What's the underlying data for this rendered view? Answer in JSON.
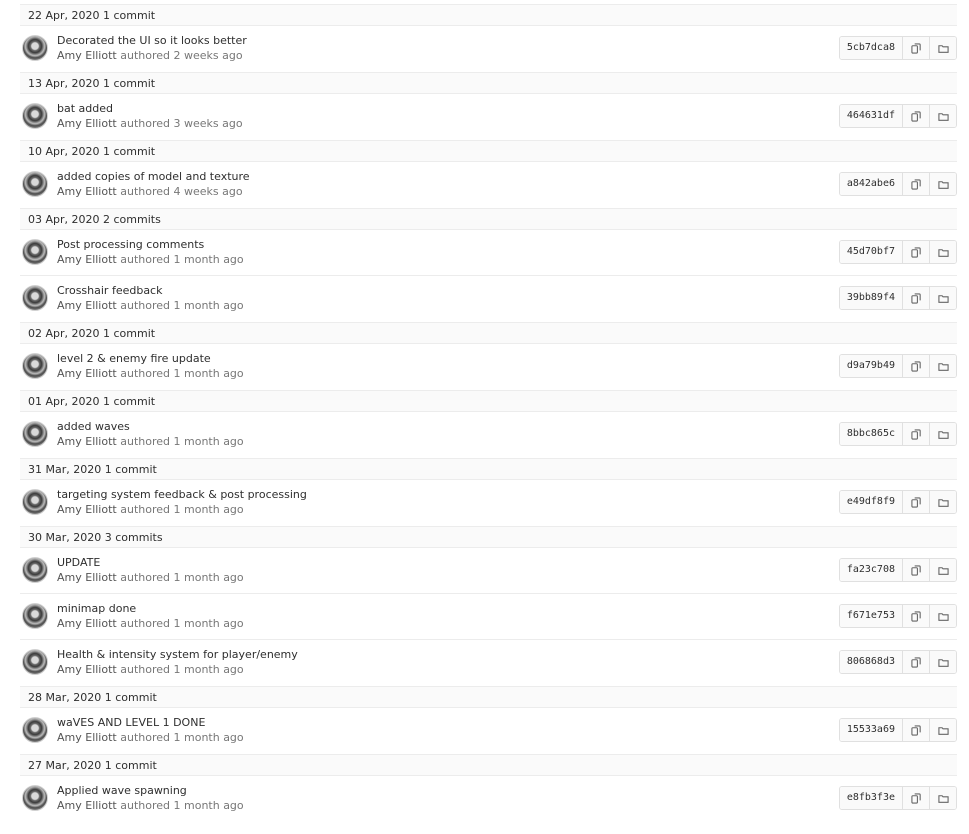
{
  "groups": [
    {
      "date": "22 Apr, 2020",
      "count": "1 commit",
      "commits": [
        {
          "title": "Decorated the UI so it looks better",
          "author": "Amy Elliott",
          "verb": "authored",
          "time": "2 weeks ago",
          "sha": "5cb7dca8"
        }
      ]
    },
    {
      "date": "13 Apr, 2020",
      "count": "1 commit",
      "commits": [
        {
          "title": "bat added",
          "author": "Amy Elliott",
          "verb": "authored",
          "time": "3 weeks ago",
          "sha": "464631df"
        }
      ]
    },
    {
      "date": "10 Apr, 2020",
      "count": "1 commit",
      "commits": [
        {
          "title": "added copies of model and texture",
          "author": "Amy Elliott",
          "verb": "authored",
          "time": "4 weeks ago",
          "sha": "a842abe6"
        }
      ]
    },
    {
      "date": "03 Apr, 2020",
      "count": "2 commits",
      "commits": [
        {
          "title": "Post processing comments",
          "author": "Amy Elliott",
          "verb": "authored",
          "time": "1 month ago",
          "sha": "45d70bf7"
        },
        {
          "title": "Crosshair feedback",
          "author": "Amy Elliott",
          "verb": "authored",
          "time": "1 month ago",
          "sha": "39bb89f4"
        }
      ]
    },
    {
      "date": "02 Apr, 2020",
      "count": "1 commit",
      "commits": [
        {
          "title": "level 2 & enemy fire update",
          "author": "Amy Elliott",
          "verb": "authored",
          "time": "1 month ago",
          "sha": "d9a79b49"
        }
      ]
    },
    {
      "date": "01 Apr, 2020",
      "count": "1 commit",
      "commits": [
        {
          "title": "added waves",
          "author": "Amy Elliott",
          "verb": "authored",
          "time": "1 month ago",
          "sha": "8bbc865c"
        }
      ]
    },
    {
      "date": "31 Mar, 2020",
      "count": "1 commit",
      "commits": [
        {
          "title": "targeting system feedback & post processing",
          "author": "Amy Elliott",
          "verb": "authored",
          "time": "1 month ago",
          "sha": "e49df8f9"
        }
      ]
    },
    {
      "date": "30 Mar, 2020",
      "count": "3 commits",
      "commits": [
        {
          "title": "UPDATE",
          "author": "Amy Elliott",
          "verb": "authored",
          "time": "1 month ago",
          "sha": "fa23c708"
        },
        {
          "title": "minimap done",
          "author": "Amy Elliott",
          "verb": "authored",
          "time": "1 month ago",
          "sha": "f671e753"
        },
        {
          "title": "Health & intensity system for player/enemy",
          "author": "Amy Elliott",
          "verb": "authored",
          "time": "1 month ago",
          "sha": "806868d3"
        }
      ]
    },
    {
      "date": "28 Mar, 2020",
      "count": "1 commit",
      "commits": [
        {
          "title": "waVES AND LEVEL 1 DONE",
          "author": "Amy Elliott",
          "verb": "authored",
          "time": "1 month ago",
          "sha": "15533a69"
        }
      ]
    },
    {
      "date": "27 Mar, 2020",
      "count": "1 commit",
      "commits": [
        {
          "title": "Applied wave spawning",
          "author": "Amy Elliott",
          "verb": "authored",
          "time": "1 month ago",
          "sha": "e8fb3f3e"
        }
      ]
    }
  ],
  "icons": {
    "copy": "copy-sha-icon",
    "browse": "folder-icon"
  }
}
